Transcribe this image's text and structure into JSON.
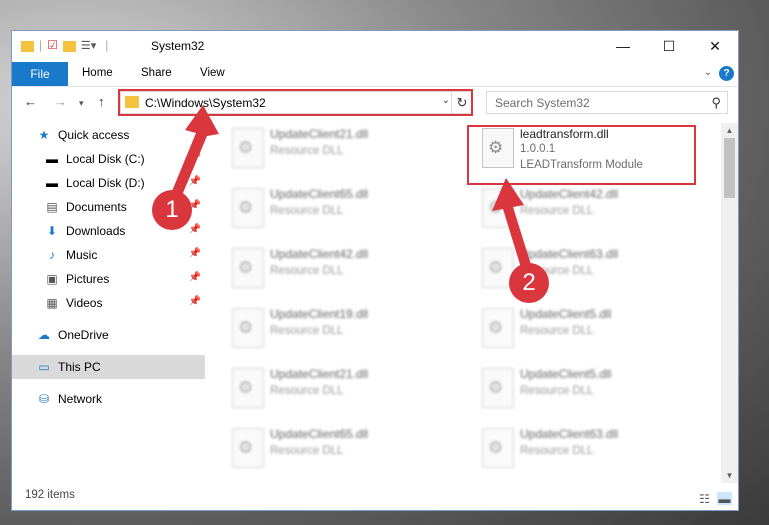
{
  "window": {
    "title": "System32",
    "controls": {
      "minimize": "—",
      "maximize": "☐",
      "close": "✕"
    }
  },
  "ribbon": {
    "file": "File",
    "tabs": [
      "Home",
      "Share",
      "View"
    ]
  },
  "address": {
    "path": "C:\\Windows\\System32",
    "search_placeholder": "Search System32"
  },
  "sidebar": {
    "items": [
      {
        "label": "Quick access",
        "icon": "star-icon"
      },
      {
        "label": "Local Disk (C:)",
        "icon": "drive-icon",
        "pinned": true
      },
      {
        "label": "Local Disk (D:)",
        "icon": "drive-icon",
        "pinned": true
      },
      {
        "label": "Documents",
        "icon": "document-icon",
        "pinned": true
      },
      {
        "label": "Downloads",
        "icon": "download-icon",
        "pinned": true
      },
      {
        "label": "Music",
        "icon": "music-icon",
        "pinned": true
      },
      {
        "label": "Pictures",
        "icon": "pictures-icon",
        "pinned": true
      },
      {
        "label": "Videos",
        "icon": "videos-icon",
        "pinned": true
      },
      {
        "label": "OneDrive",
        "icon": "cloud-icon"
      },
      {
        "label": "This PC",
        "icon": "computer-icon",
        "selected": true
      },
      {
        "label": "Network",
        "icon": "network-icon"
      }
    ]
  },
  "files": {
    "highlighted": {
      "name": "leadtransform.dll",
      "version": "1.0.0.1",
      "description": "LEADTransform Module"
    },
    "left": [
      {
        "name": "UpdateClient21.dll",
        "description": "Resource DLL"
      },
      {
        "name": "UpdateClient65.dll",
        "description": "Resource DLL"
      },
      {
        "name": "UpdateClient42.dll",
        "description": "Resource DLL"
      },
      {
        "name": "UpdateClient19.dll",
        "description": "Resource DLL"
      },
      {
        "name": "UpdateClient21.dll",
        "description": "Resource DLL"
      },
      {
        "name": "UpdateClient65.dll",
        "description": "Resource DLL"
      }
    ],
    "right": [
      {
        "name": "UpdateClient42.dll",
        "description": "Resource DLL"
      },
      {
        "name": "UpdateClient63.dll",
        "description": "Resource DLL"
      },
      {
        "name": "UpdateClient5.dll",
        "description": "Resource DLL"
      },
      {
        "name": "UpdateClient5.dll",
        "description": "Resource DLL"
      },
      {
        "name": "UpdateClient63.dll",
        "description": "Resource DLL"
      }
    ]
  },
  "status": {
    "items_count": "192 items"
  },
  "annotations": {
    "step1": "1",
    "step2": "2"
  },
  "colors": {
    "accent": "#1979ca",
    "highlight_red": "#d9373d"
  }
}
